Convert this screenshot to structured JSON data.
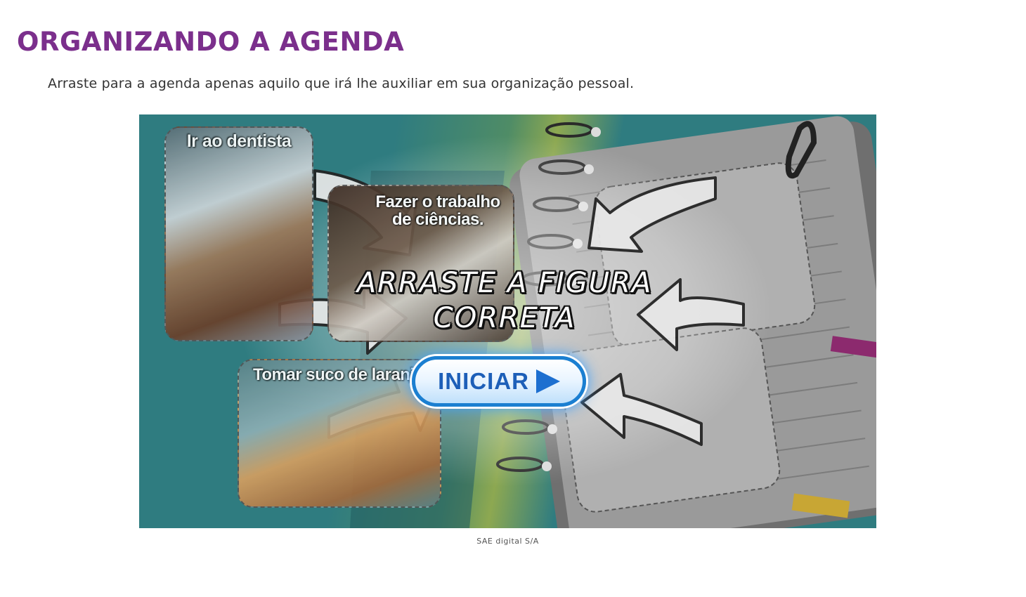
{
  "page": {
    "title": "ORGANIZANDO A AGENDA",
    "instruction": "Arraste para a agenda apenas aquilo que irá lhe auxiliar em sua organização pessoal."
  },
  "activity": {
    "cards": [
      {
        "label": "Ir ao dentista"
      },
      {
        "label": "Fazer o trabalho de ciências."
      },
      {
        "label": "Tomar suco de laranja"
      }
    ],
    "overlay_line1": "ARRASTE A FIGURA",
    "overlay_line2": "CORRETA",
    "start_button": "INICIAR",
    "start_icon": "play-triangle-icon",
    "colors": {
      "background": "#2f7c80",
      "title": "#7b2f8c",
      "button_border": "#1b7fd1",
      "button_text": "#1d5fb8"
    }
  },
  "caption": "SAE digital S/A"
}
